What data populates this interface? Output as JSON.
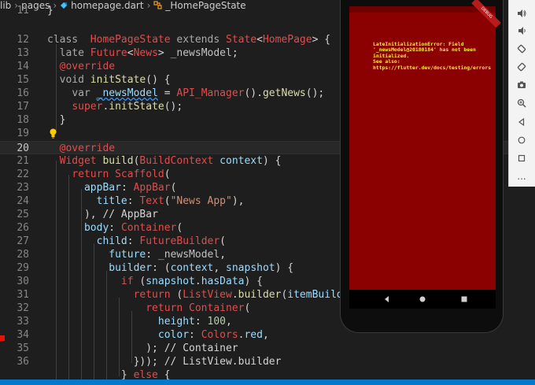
{
  "breadcrumb": {
    "seg1": "lib",
    "seg2": "pages",
    "seg3": "homepage.dart",
    "seg4": "_HomePageState"
  },
  "editor": {
    "line_numbers": [
      "11",
      "12",
      "13",
      "14",
      "15",
      "16",
      "17",
      "18",
      "19",
      "20",
      "21",
      "22",
      "23",
      "24",
      "25",
      "26",
      "27",
      "28",
      "29",
      "30",
      "31",
      "32",
      "33",
      "34",
      "35",
      "36"
    ],
    "current_line": "20",
    "error_line": "34"
  },
  "emulator": {
    "debug_banner": "DEBUG",
    "error_message": "LateInitializationError: Field '_newsModel@20180184' has not been initialized.\nSee also: https://flutter.dev/docs/testing/errors"
  },
  "toolbar": {
    "items": [
      "volume-up-icon",
      "volume-down-icon",
      "rotate-left-icon",
      "rotate-right-icon",
      "camera-icon",
      "zoom-in-icon",
      "back-icon",
      "home-icon",
      "overview-icon",
      "more-icon"
    ],
    "more_label": "..."
  },
  "colors": {
    "editor_bg": "#1e1e1e",
    "status_bar": "#007acc",
    "error_screen": "#8b0000",
    "error_text": "#ffeb3b"
  }
}
